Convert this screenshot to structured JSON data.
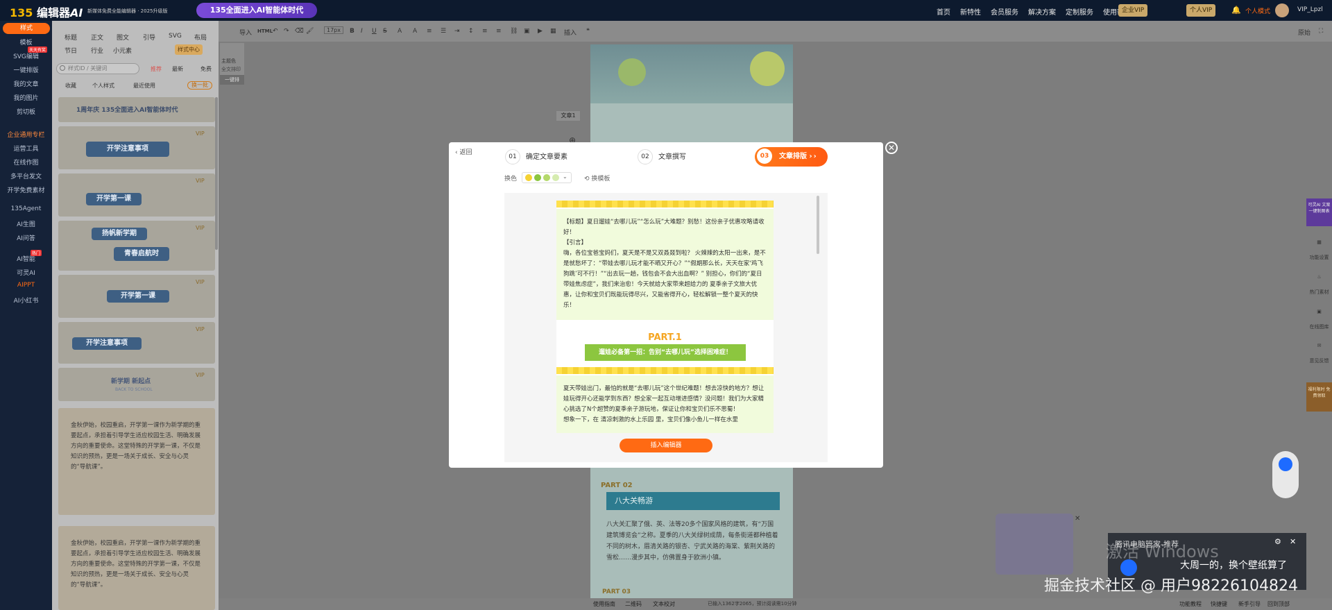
{
  "topbar": {
    "logo_num": "135",
    "logo_text": "编辑器",
    "logo_ai": "AI",
    "logo_sub": "新媒体免费全能编辑器 · 2025升级版",
    "banner": "135全面进入AI智能体时代",
    "nav": [
      "首页",
      "新特性",
      "会员服务",
      "解决方案",
      "定制服务",
      "使用帮助"
    ],
    "vip1": "企业VIP",
    "vip2": "个人VIP",
    "personal": "个人模式",
    "user": "VIP_Lpzl"
  },
  "leftnav": {
    "items": [
      "样式",
      "模板",
      "SVG编辑",
      "一键排版",
      "我的文章",
      "我的图片",
      "剪切板"
    ],
    "section": "企业通用专栏",
    "items2": [
      "运营工具",
      "在线作图",
      "多平台发文",
      "开学免费素材"
    ],
    "items3": [
      "135Agent",
      "AI生图",
      "AI问答"
    ],
    "items4": [
      "AI智能",
      "可灵AI",
      "AIPPT",
      "AI小红书"
    ],
    "badge": "天天有奖",
    "badge2": "热门"
  },
  "panel": {
    "cats_row1": [
      "标题",
      "正文",
      "图文",
      "引导",
      "SVG",
      "布局"
    ],
    "cats_row2": [
      "节日",
      "行业",
      "小元素"
    ],
    "style_center": "样式中心",
    "search_placeholder": "样式ID / 关键词",
    "filters": [
      "推荐",
      "最新",
      "免费"
    ],
    "tabs": [
      "收藏",
      "个人样式",
      "最近使用"
    ],
    "refresh": "换一批",
    "cards": [
      "1周年庆 135全面进入AI智能体时代",
      "开学注意事项",
      "开学第一课",
      "扬帆新学期",
      "青春启航时",
      "开学第一课",
      "开学注意事项",
      "新学期 新起点",
      "BACK TO SCHOOL"
    ],
    "vip": "VIP",
    "text1": "金秋伊始，校园重启，开学第一课作为新学期的重要起点，承担着引导学生适应校园生活、明确发展方向的重要使命。这堂特殊的开学第一课，不仅是知识的预热，更是一场关于成长、安全与心灵的“导航课”。",
    "text2": "金秋伊始，校园重启，开学第一课作为新学期的重要起点，承担着引导学生适应校园生活、明确发展方向的重要使命。这堂特殊的开学第一课，不仅是知识的预热，更是一场关于成长、安全与心灵的“导航课”。"
  },
  "toolbar": {
    "import": "导入",
    "html": "HTML",
    "font_size": "17px",
    "insert": "插入",
    "zoom": "原始"
  },
  "left_tools": {
    "tool1": "主题色",
    "tool2": "全文排印",
    "tool3": "一键排"
  },
  "doc": {
    "label": "文章1",
    "part02": "PART 02",
    "title": "八大关畅游",
    "text": "八大关汇聚了俄、英、法等20多个国家风格的建筑，有“万国建筑博览会”之称。夏季的八大关绿树成荫，每条街道都种植着不同的树木，眉清关路的银杏、宁武关路的海棠、紫荆关路的雪松……漫步其中，仿佛置身于欧洲小镇。",
    "part03": "PART 03"
  },
  "right_rail": {
    "promo": "可灵AI 文案一键制图表",
    "items": [
      "功能设置",
      "热门素材",
      "在线图库",
      "意见反馈"
    ],
    "promo2": "福利限时 免费领取"
  },
  "modal": {
    "back": "返回",
    "steps": [
      {
        "num": "01",
        "label": "确定文章要素"
      },
      {
        "num": "02",
        "label": "文章撰写"
      },
      {
        "num": "03",
        "label": "文章排版"
      }
    ],
    "color_label": "换色",
    "reset_label": "换模板",
    "swatches": [
      "#f5d233",
      "#8cc63f",
      "#b4d96b",
      "#d6ecb0"
    ],
    "intro": "【标题】夏日遛娃“去哪儿玩”“怎么玩”大难题？别愁！这份亲子优惠攻略请收好！\n【引言】\n嗨，各位宝爸宝妈们，夏天是不是又双叒叕到啦？ 火辣辣的太阳一出来，是不是就愁坏了：“带娃去哪儿玩才能不晒又开心？”“假期那么长，天天在家‘鸡飞狗跳’可不行！”“出去玩一趟，钱包会不会大出血啊？” 别担心，你们的“夏日带娃焦虑症”，我们来治愈！今天就给大家带来超给力的 夏季亲子文旅大优惠，让你和宝贝们既能玩得尽兴，又能省得开心，轻松解锁一整个夏天的快乐！",
    "part": "PART.1",
    "part_title": "遛娃必备第一招：告别“去哪儿玩”选择困难症！",
    "body": "夏天带娃出门，最怕的就是“去哪儿玩”这个世纪难题！想去凉快的地方？想让娃玩得开心还能学到东西？想全家一起互动增进感情？没问题！我们为大家精心挑选了N个超赞的夏季亲子游玩地，保证让你和宝贝们乐不思蜀！\n想象一下，在 清凉刺激的水上乐园 里，宝贝们像小鱼儿一样在水里",
    "insert_btn": "插入编辑器"
  },
  "notification": {
    "title": "腾讯电脑管家-推荐",
    "line": "大周一的，换个壁纸算了"
  },
  "watermark": "掘金技术社区 @ 用户98226104824",
  "win_wm": "激活 Windows",
  "bottom": {
    "items": [
      "使用指南",
      "二维码",
      "文本校对"
    ],
    "count": "已输入1362字2065，预计阅读需10分钟",
    "right": [
      "功能教程",
      "快捷键",
      "新手引导",
      "回到顶部"
    ]
  }
}
